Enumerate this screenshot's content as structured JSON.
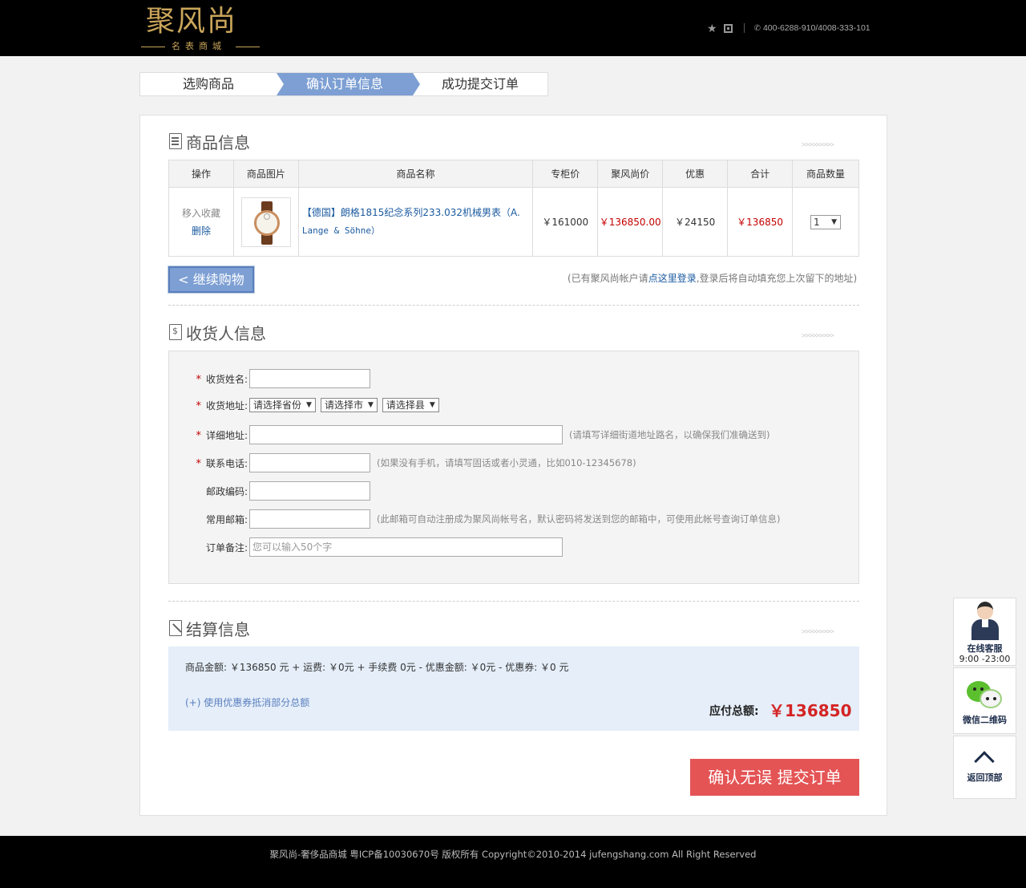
{
  "header": {
    "logo_main": "聚风尚",
    "logo_sub": "名表商城",
    "phone": "400-6288-910/4008-333-101"
  },
  "steps": [
    "选购商品",
    "确认订单信息",
    "成功提交订单"
  ],
  "product_section": {
    "title": "商品信息",
    "chevrons": ">>>>>>>>>",
    "columns": [
      "操作",
      "商品图片",
      "商品名称",
      "专柜价",
      "聚风尚价",
      "优惠",
      "合计",
      "商品数量"
    ],
    "row": {
      "op_fav": "移入收藏",
      "op_delete": "删除",
      "name_cn": "【德国】朗格1815纪念系列233.032机械男表（A.",
      "name_en": "Lange & Söhne）",
      "counter_price": "￥161000",
      "our_price": "￥136850.00",
      "discount": "￥24150",
      "total": "￥136850",
      "qty": "1"
    },
    "continue_label": "< 继续购物",
    "login_tip_pre": "(已有聚风尚帐户请",
    "login_tip_link": "点这里登录",
    "login_tip_post": ",登录后将自动填充您上次留下的地址)"
  },
  "receiver_section": {
    "title": "收货人信息",
    "chevrons": ">>>>>>>>>",
    "name_label": "收货姓名:",
    "address_label": "收货地址:",
    "province": "请选择省份",
    "city": "请选择市",
    "county": "请选择县",
    "detail_label": "详细地址:",
    "detail_hint": "(请填写详细街道地址路名，以确保我们准确送到)",
    "phone_label": "联系电话:",
    "phone_hint": "(如果没有手机，请填写固话或者小灵通，比如010-12345678)",
    "zip_label": "邮政编码:",
    "email_label": "常用邮箱:",
    "email_hint": "(此邮箱可自动注册成为聚风尚帐号名，默认密码将发送到您的邮箱中，可使用此帐号查询订单信息)",
    "note_label": "订单备注:",
    "note_placeholder": "您可以输入50个字"
  },
  "settle_section": {
    "title": "结算信息",
    "chevrons": ">>>>>>>>>",
    "summary": "商品金额: ￥136850 元 + 运费: ￥0元 + 手续费 0元 - 优惠金额: ￥0元 - 优惠券: ￥0 元",
    "coupon_link": "(+) 使用优惠券抵消部分总额",
    "total_label": "应付总额:",
    "total_value": "￥136850"
  },
  "submit_label": "确认无误 提交订单",
  "footer": "聚风尚-奢侈品商城 粤ICP备10030670号 版权所有 Copyright©2010-2014 jufengshang.com All Right Reserved",
  "side": {
    "cs_label": "在线客服",
    "cs_hours": "9:00 -23:00",
    "wechat_label": "微信二维码",
    "top_label": "返回顶部"
  },
  "colors": {
    "accent_blue": "#7d9fd3",
    "price_red": "#c40000",
    "submit_red": "#e45455",
    "settle_bg": "#e5eef9"
  }
}
